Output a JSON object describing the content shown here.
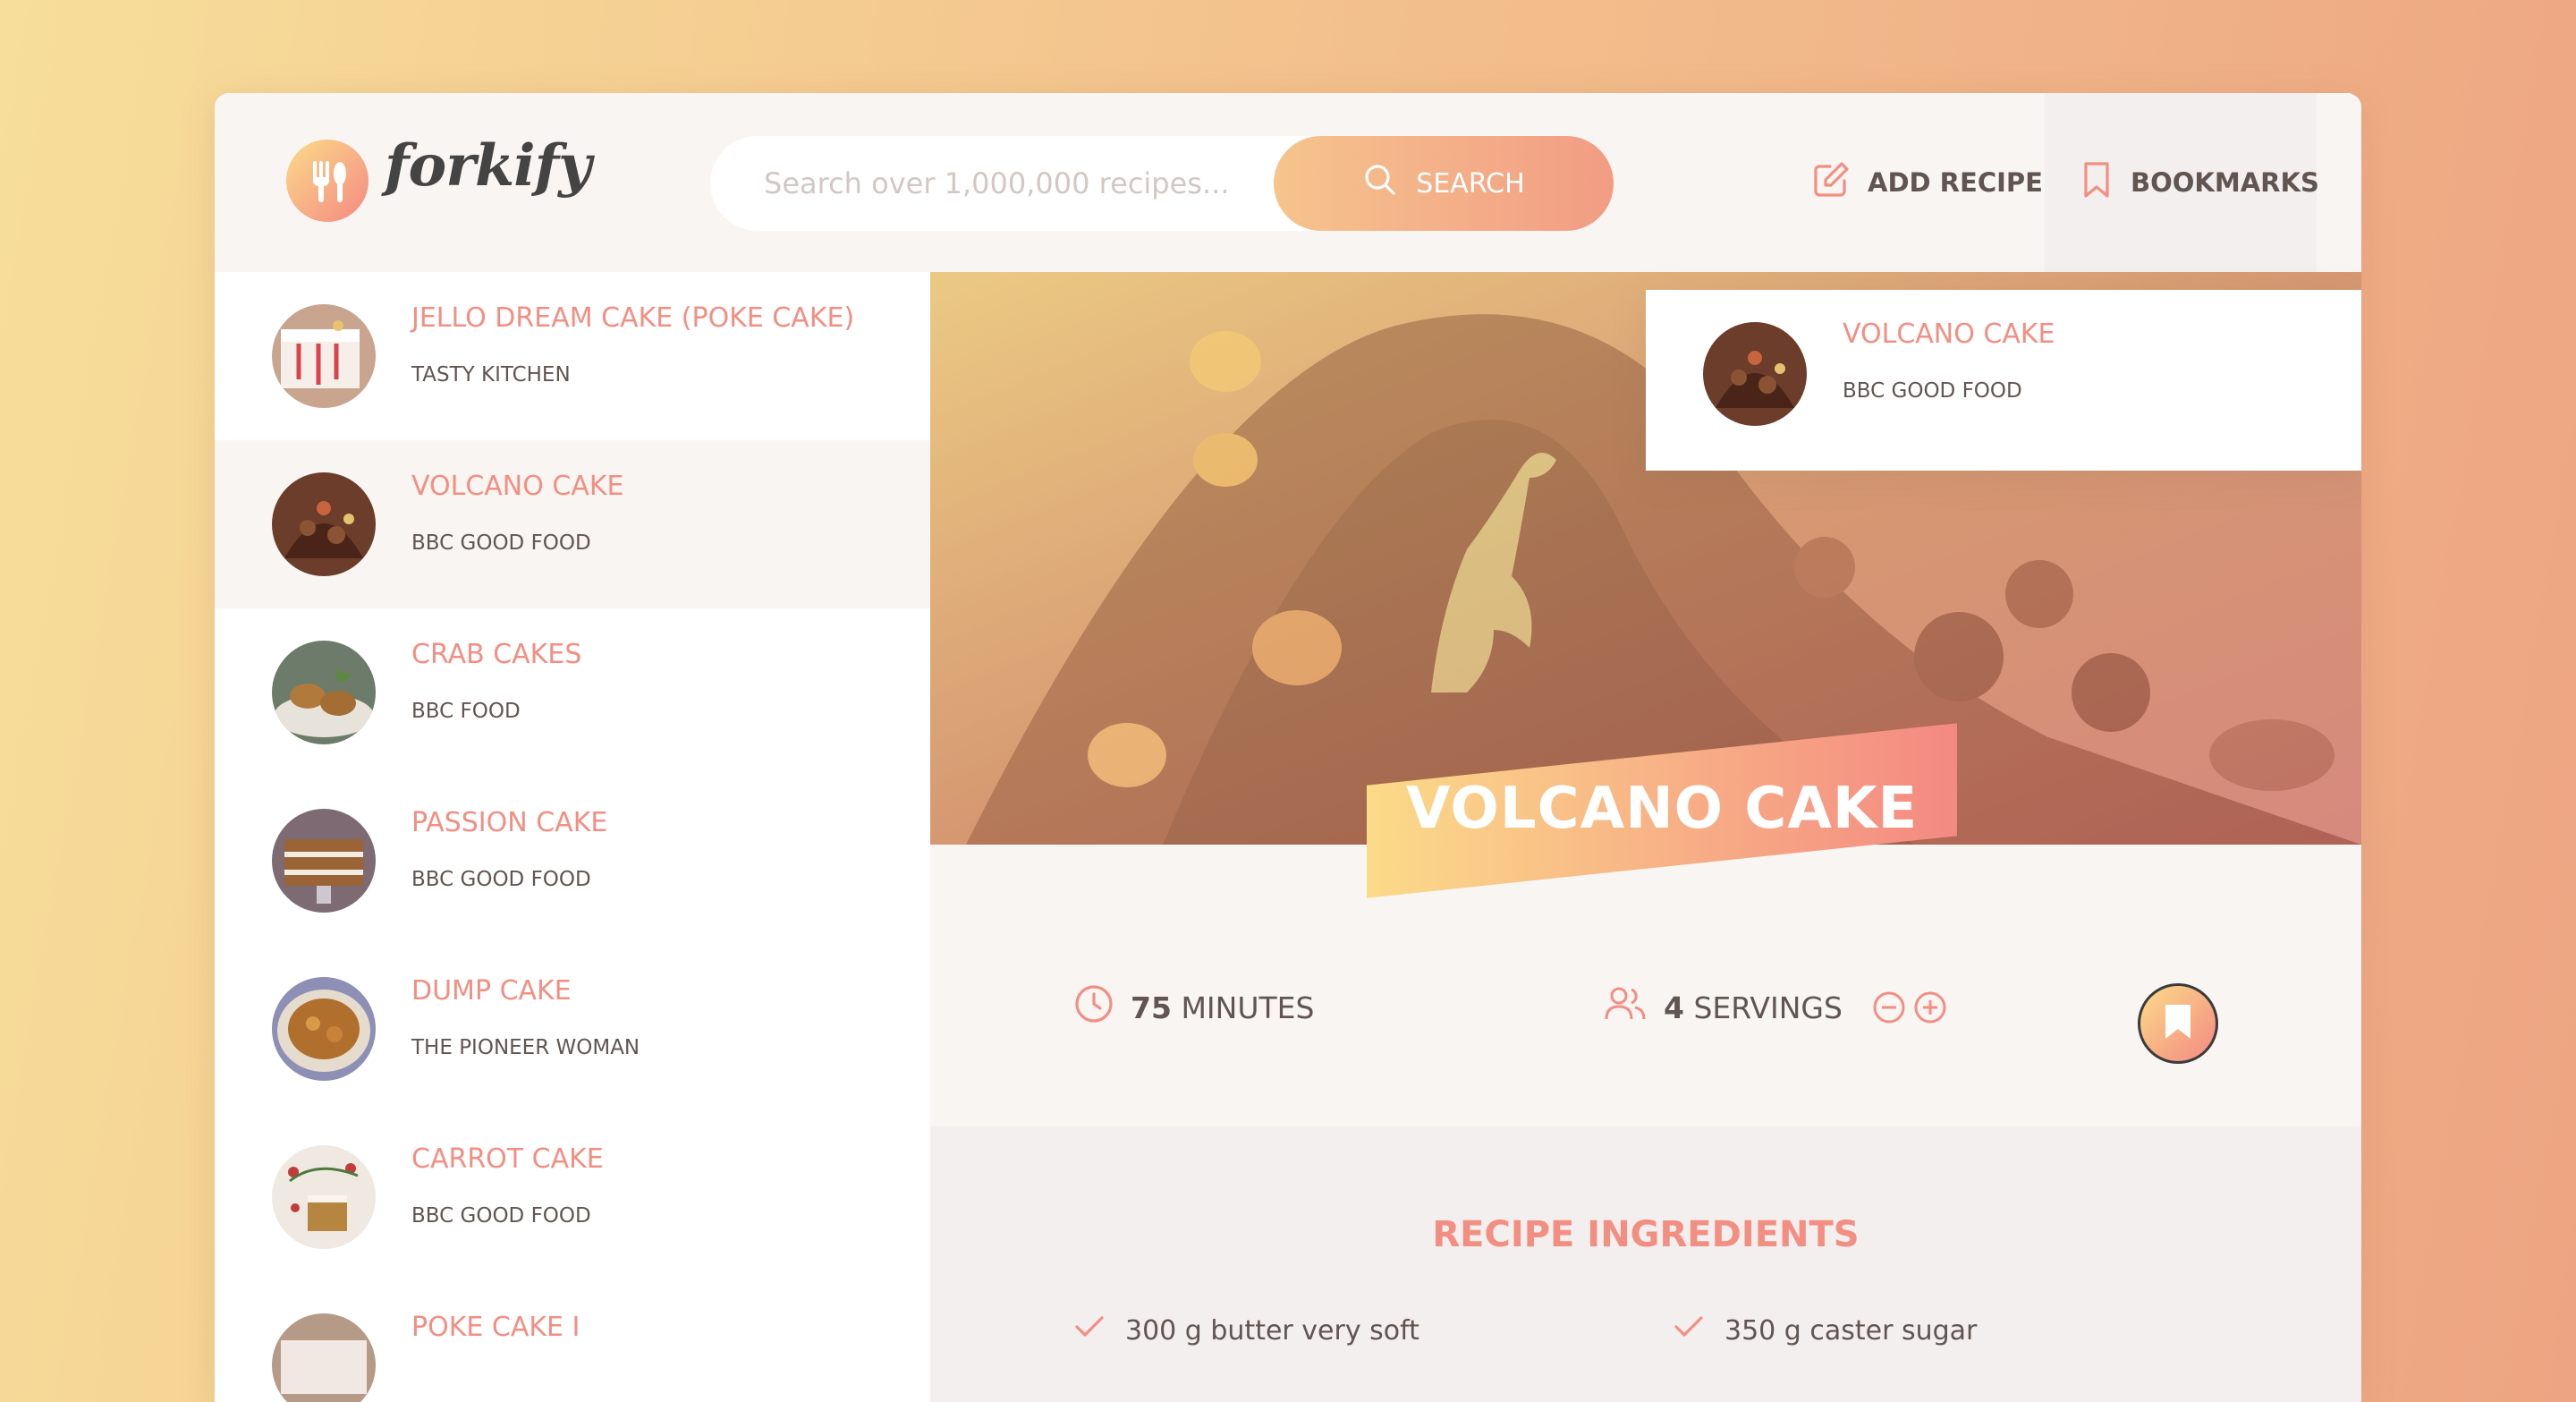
{
  "brand": {
    "name": "forkify"
  },
  "search": {
    "placeholder": "Search over 1,000,000 recipes...",
    "value": "",
    "button_label": "SEARCH"
  },
  "nav": {
    "add_recipe": "ADD RECIPE",
    "bookmarks": "BOOKMARKS"
  },
  "results": [
    {
      "title": "JELLO DREAM CAKE (POKE CAKE)",
      "publisher": "TASTY KITCHEN",
      "active": false
    },
    {
      "title": "VOLCANO CAKE",
      "publisher": "BBC GOOD FOOD",
      "active": true
    },
    {
      "title": "CRAB CAKES",
      "publisher": "BBC FOOD",
      "active": false
    },
    {
      "title": "PASSION CAKE",
      "publisher": "BBC GOOD FOOD",
      "active": false
    },
    {
      "title": "DUMP CAKE",
      "publisher": "THE PIONEER WOMAN",
      "active": false
    },
    {
      "title": "CARROT CAKE",
      "publisher": "BBC GOOD FOOD",
      "active": false
    },
    {
      "title": "POKE CAKE I",
      "publisher": "",
      "active": false
    }
  ],
  "bookmarks_preview": [
    {
      "title": "VOLCANO CAKE",
      "publisher": "BBC GOOD FOOD"
    }
  ],
  "recipe": {
    "title": "VOLCANO CAKE",
    "cooking_time": "75",
    "time_unit": "MINUTES",
    "servings": "4",
    "servings_unit": "SERVINGS",
    "ingredients_heading": "RECIPE INGREDIENTS",
    "ingredients": [
      "300 g butter very soft",
      "350 g caster sugar"
    ]
  },
  "colors": {
    "accent": "#f38e82",
    "gradient_start": "#fbdb89",
    "gradient_end": "#f48982",
    "text": "#615551",
    "panel": "#f9f5f3"
  },
  "icons": [
    "fork-knife-logo-icon",
    "search-icon",
    "edit-icon",
    "bookmark-icon",
    "clock-icon",
    "users-icon",
    "minus-circle-icon",
    "plus-circle-icon",
    "check-icon"
  ]
}
